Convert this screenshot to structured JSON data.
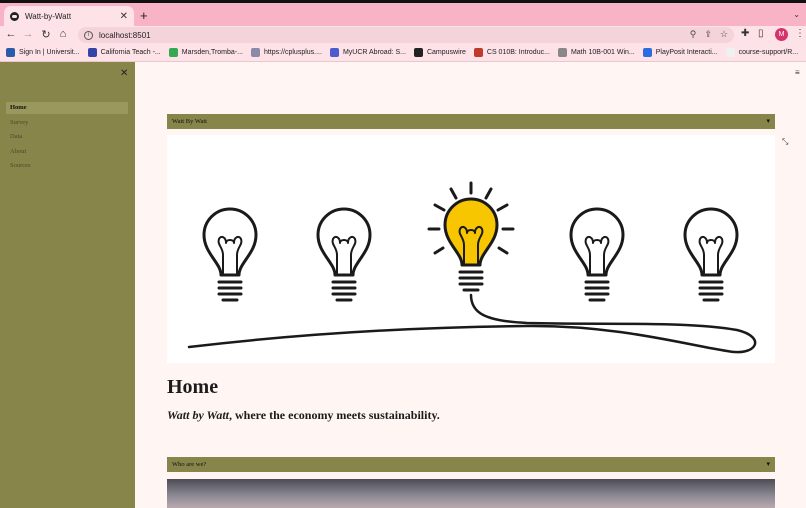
{
  "browser": {
    "tab_title": "Watt-by-Watt",
    "tab_close": "✕",
    "new_tab": "+",
    "tab_menu": "⌄",
    "url": "localhost:8501",
    "avatar_letter": "M",
    "bookmarks": [
      {
        "label": "Sign In | Universit...",
        "color": "#2a5caa"
      },
      {
        "label": "California Teach -...",
        "color": "#3346a8"
      },
      {
        "label": "Marsden,Tromba-...",
        "color": "#34a853"
      },
      {
        "label": "https://cplusplus....",
        "color": "#8a8aa8"
      },
      {
        "label": "MyUCR Abroad: S...",
        "color": "#4d5bd1"
      },
      {
        "label": "Campuswire",
        "color": "#222222"
      },
      {
        "label": "CS 010B: Introduc...",
        "color": "#c0392b"
      },
      {
        "label": "Math 10B-001 Win...",
        "color": "#888888"
      },
      {
        "label": "PlayPosit Interacti...",
        "color": "#2d6cdf"
      },
      {
        "label": "course-support/R...",
        "color": "#f0f0f0"
      }
    ]
  },
  "sidebar": {
    "close": "✕",
    "items": [
      {
        "label": "Home",
        "active": true
      },
      {
        "label": "Survey",
        "active": false
      },
      {
        "label": "Data",
        "active": false
      },
      {
        "label": "About",
        "active": false
      },
      {
        "label": "Sources",
        "active": false
      }
    ]
  },
  "main": {
    "menu_icon": "≡",
    "expand_icon": "⤡",
    "expander1_label": "Watt By Watt",
    "caret": "▾",
    "title": "Home",
    "tagline_emph": "Watt by Watt",
    "tagline_rest": ", where the economy meets sustainability.",
    "expander2_label": "Who are we?"
  },
  "colors": {
    "sidebar": "#878549",
    "bulb_lit": "#f7c600",
    "page_bg": "#fff5f2"
  }
}
